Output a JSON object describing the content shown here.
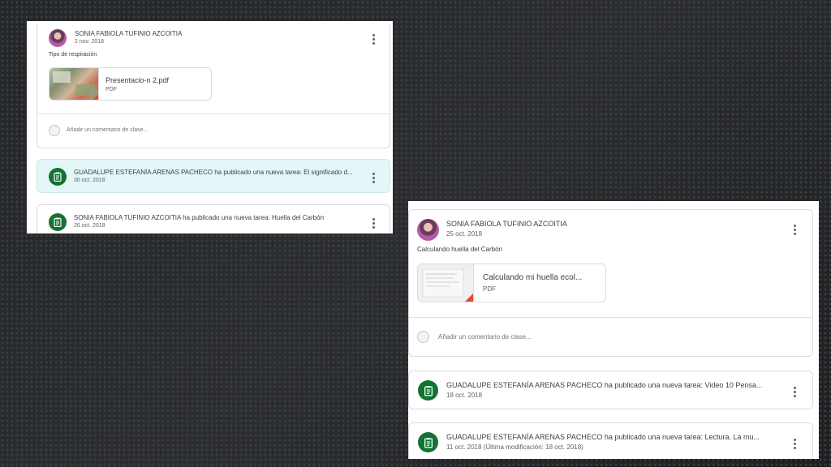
{
  "left": {
    "post": {
      "author": "SONIA FABIOLA TUFINIO AZCOITIA",
      "date": "2 nov. 2018",
      "text": "Tipo de respiración",
      "attachment": {
        "title": "Presentacio-n 2.pdf",
        "type": "PDF"
      },
      "comment_placeholder": "Añadir un comentario de clase..."
    },
    "tasks": [
      {
        "text": "GUADALUPE ESTEFANÍA ARENAS PACHECO ha publicado una nueva tarea: El significado d...",
        "date": "30 oct. 2018"
      },
      {
        "text": "SONIA FABIOLA TUFINIO AZCOITIA ha publicado una nueva tarea: Huella del Carbón",
        "date": "26 oct. 2018"
      }
    ]
  },
  "right": {
    "post": {
      "author": "SONIA FABIOLA TUFINIO AZCOITIA",
      "date": "25 oct. 2018",
      "text": "Calculando huella del Carbón",
      "attachment": {
        "title": "Calculando mi huella ecol...",
        "type": "PDF"
      },
      "comment_placeholder": "Añadir un comentario de clase..."
    },
    "tasks": [
      {
        "text": "GUADALUPE ESTEFANÍA ARENAS PACHECO ha publicado una nueva tarea: Video 10 Pensa...",
        "date": "18 oct. 2018"
      },
      {
        "text": "GUADALUPE ESTEFANÍA ARENAS PACHECO ha publicado una nueva tarea: Lectura. La mu...",
        "date": "11 oct. 2018 (Última modificación: 18 oct. 2018)"
      }
    ]
  },
  "colors": {
    "accent": "#137333",
    "highlight": "#e3f6f8"
  },
  "icons": {
    "task": "assignment-icon",
    "menu": "more-vert-icon"
  }
}
